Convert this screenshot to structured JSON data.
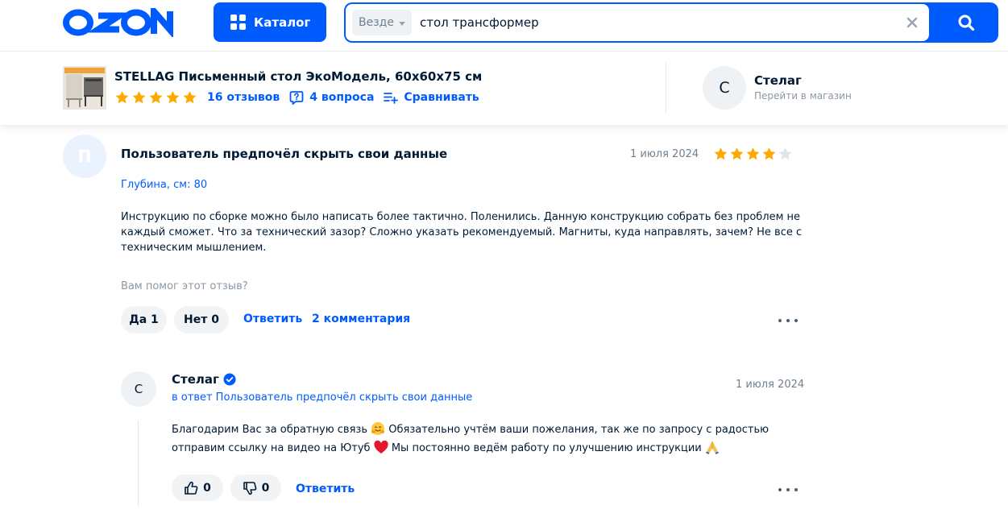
{
  "header": {
    "logo_text": "OZON",
    "catalog_label": "Каталог",
    "search": {
      "scope": "Везде",
      "query": "стол трансформер"
    },
    "colors": {
      "brand": "#005bff"
    }
  },
  "product": {
    "title": "STELLAG Письменный стол ЭкоМодель, 60х60х75 см",
    "rating_stars": 5,
    "reviews_link": "16 отзывов",
    "questions_link": "4 вопроса",
    "compare_link": "Сравнивать",
    "shop": {
      "avatar_letter": "С",
      "name": "Стелаг",
      "link": "Перейти в магазин"
    }
  },
  "review": {
    "avatar_letter": "П",
    "author": "Пользователь предпочёл скрыть свои данные",
    "date": "1 июля 2024",
    "rating": 4,
    "param": "Глубина, см: 80",
    "text": "Инструкцию по сборке можно было написать более тактично. Поленились. Данную конструкцию собрать без проблем не каждый сможет. Что за технический зазор? Сложно указать рекомендуемый. Магниты, куда направлять, зачем? Не все с техническим мышлением.",
    "helpful_question": "Вам помог этот отзыв?",
    "yes_label": "Да 1",
    "no_label": "Нет 0",
    "reply_link": "Ответить",
    "comments_link": "2 комментария"
  },
  "seller_reply": {
    "avatar_letter": "С",
    "author": "Стелаг",
    "in_reply_to": "в ответ Пользователь предпочёл скрыть свои данные",
    "date": "1 июля 2024",
    "text_part1": "Благодарим Вас за обратную связь",
    "text_part2": " Обязательно учтём ваши пожелания, так же по запросу с радостью отправим ссылку на видео на Ютуб",
    "text_part3": " Мы постоянно ведём работу по улучшению инструкции",
    "likes": "0",
    "dislikes": "0",
    "reply_link": "Ответить"
  },
  "icons": {
    "catalog": "grid-icon",
    "search": "search-icon",
    "clear": "close-icon",
    "star": "star-icon",
    "question": "question-icon",
    "compare": "compare-icon",
    "verified": "verified-badge-icon",
    "like": "thumbs-up-icon",
    "dislike": "thumbs-down-icon",
    "more": "more-dots-icon"
  }
}
